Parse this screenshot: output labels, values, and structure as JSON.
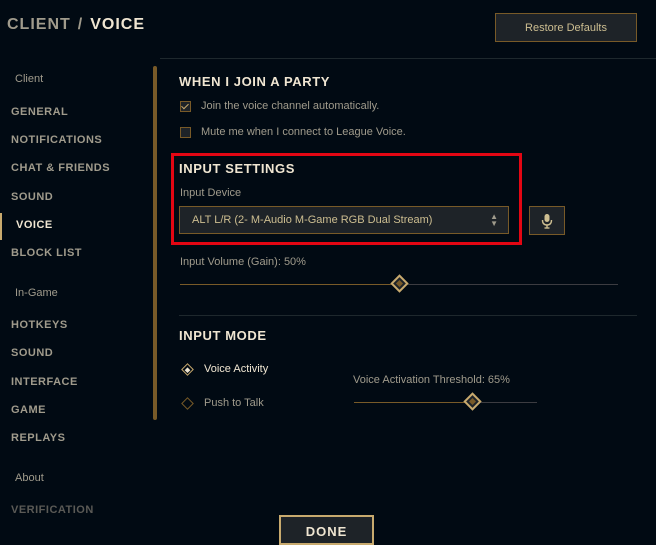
{
  "header": {
    "breadcrumb_root": "CLIENT",
    "breadcrumb_sep": "/",
    "breadcrumb_current": "VOICE",
    "restore_label": "Restore Defaults"
  },
  "sidebar": {
    "client_section": "Client",
    "client_items": [
      "GENERAL",
      "NOTIFICATIONS",
      "CHAT & FRIENDS",
      "SOUND",
      "VOICE",
      "BLOCK LIST"
    ],
    "ingame_section": "In-Game",
    "ingame_items": [
      "HOTKEYS",
      "SOUND",
      "INTERFACE",
      "GAME",
      "REPLAYS"
    ],
    "about_section": "About",
    "about_items": [
      "VERIFICATION"
    ],
    "active_item": "VOICE"
  },
  "party": {
    "title": "WHEN I JOIN A PARTY",
    "join_label": "Join the voice channel automatically.",
    "join_checked": true,
    "mute_label": "Mute me when I connect to League Voice.",
    "mute_checked": false
  },
  "input_settings": {
    "title": "INPUT SETTINGS",
    "device_label": "Input Device",
    "device_value": "ALT L/R (2- M-Audio M-Game RGB Dual Stream)",
    "mic_icon": "microphone-icon",
    "volume_label": "Input Volume (Gain): 50%",
    "volume_fraction": 0.5
  },
  "input_mode": {
    "title": "INPUT MODE",
    "voice_activity_label": "Voice Activity",
    "push_to_talk_label": "Push to Talk",
    "selected": "Voice Activity",
    "threshold_label": "Voice Activation Threshold: 65%",
    "threshold_fraction": 0.65
  },
  "footer": {
    "done_label": "DONE"
  },
  "colors": {
    "background": "#010a13",
    "gold": "#c8aa6e",
    "gold_dark": "#785a28",
    "text": "#a09b8c",
    "text_bright": "#f0e6d2",
    "highlight": "#e30613"
  }
}
